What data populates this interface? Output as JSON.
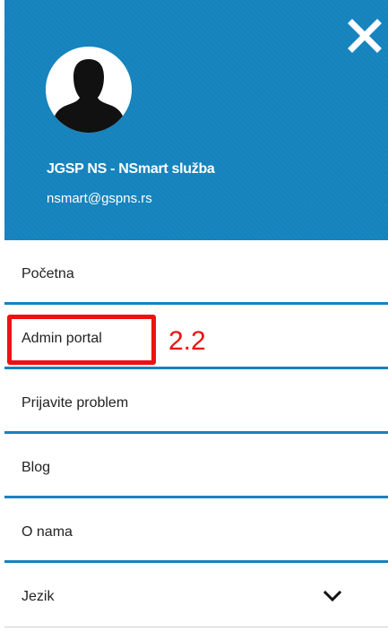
{
  "header": {
    "user_name": "JGSP NS - NSmart služba",
    "user_email": "nsmart@gspns.rs",
    "close_icon": "close-icon",
    "avatar_icon": "user-silhouette-icon"
  },
  "menu": {
    "items": [
      {
        "label": "Početna"
      },
      {
        "label": "Admin portal"
      },
      {
        "label": "Prijavite problem"
      },
      {
        "label": "Blog"
      },
      {
        "label": "O nama"
      },
      {
        "label": "Jezik",
        "icon": "chevron-down-icon"
      }
    ]
  },
  "annotation": {
    "step_label": "2.2"
  },
  "colors": {
    "header_bg": "#1583bd",
    "divider": "#1583bd",
    "annotation": "#ee1111"
  }
}
